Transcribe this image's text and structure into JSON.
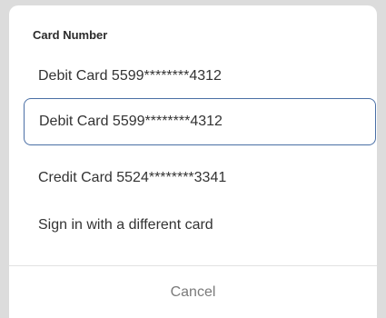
{
  "sheet": {
    "title": "Card Number",
    "options": [
      {
        "label": "Debit Card 5599********4312",
        "selected": false
      },
      {
        "label": "Debit Card 5599********4312",
        "selected": true
      },
      {
        "label": "Credit Card 5524********3341",
        "selected": false
      },
      {
        "label": "Sign in with a different card",
        "selected": false
      }
    ],
    "cancel_label": "Cancel"
  },
  "colors": {
    "selected_border": "#4a6fa5",
    "cancel_text": "#7a7a7a"
  }
}
